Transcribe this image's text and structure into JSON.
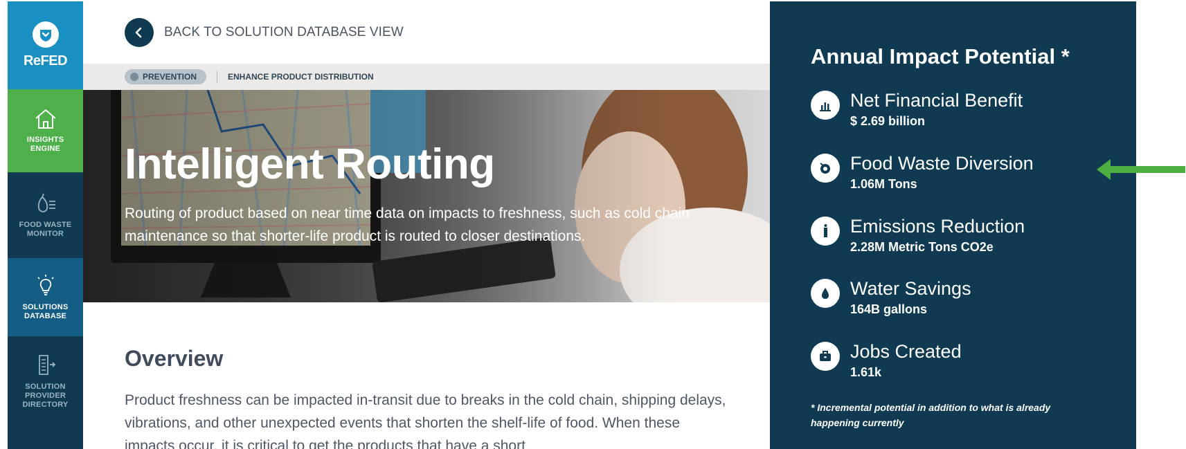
{
  "sidebar": {
    "logo_text": "ReFED",
    "items": [
      {
        "label": "INSIGHTS\nENGINE",
        "icon": "house-icon"
      },
      {
        "label": "FOOD WASTE\nMONITOR",
        "icon": "pear-list-icon"
      },
      {
        "label": "SOLUTIONS\nDATABASE",
        "icon": "lightbulb-icon"
      },
      {
        "label": "SOLUTION\nPROVIDER\nDIRECTORY",
        "icon": "directory-icon"
      }
    ]
  },
  "main": {
    "back_label": "BACK TO SOLUTION DATABASE VIEW",
    "breadcrumb": {
      "category": "PREVENTION",
      "subcategory": "ENHANCE PRODUCT DISTRIBUTION"
    },
    "hero": {
      "title": "Intelligent Routing",
      "description": "Routing of product based on near time data on impacts to freshness, such as cold chain maintenance so that shorter-life product is routed to closer destinations."
    },
    "overview": {
      "title": "Overview",
      "text": "Product freshness can be impacted in-transit due to breaks in the cold chain, shipping delays, vibrations, and other unexpected events that shorten the shelf-life of food. When these impacts occur, it is critical to get the products that have a short"
    }
  },
  "panel": {
    "title": "Annual Impact Potential *",
    "metrics": [
      {
        "label": "Net Financial Benefit",
        "value": "$ 2.69 billion",
        "icon": "bar-chart-icon"
      },
      {
        "label": "Food Waste Diversion",
        "value": "1.06M Tons",
        "icon": "food-bowl-icon"
      },
      {
        "label": "Emissions Reduction",
        "value": "2.28M Metric Tons CO2e",
        "icon": "smokestack-icon"
      },
      {
        "label": "Water Savings",
        "value": "164B gallons",
        "icon": "water-drop-icon"
      },
      {
        "label": "Jobs Created",
        "value": "1.61k",
        "icon": "briefcase-icon"
      }
    ],
    "footnote": "* Incremental potential in addition to what is already happening currently"
  },
  "colors": {
    "sidebar": "#0f3a52",
    "logo_bg": "#1a8fc2",
    "insights_active": "#4db04a",
    "solutions_active": "#145e86",
    "panel": "#0f3a52",
    "arrow": "#4caf3f"
  }
}
